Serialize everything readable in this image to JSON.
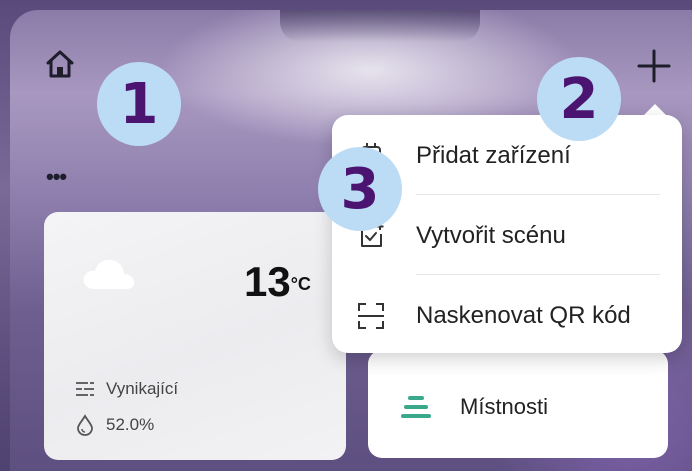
{
  "badges": {
    "one": "1",
    "two": "2",
    "three": "3"
  },
  "weather": {
    "temperature": "13",
    "unit": "°C",
    "air_quality": "Vynikající",
    "humidity": "52.0%"
  },
  "rooms": {
    "label": "Místnosti"
  },
  "menu": {
    "items": [
      {
        "label": "Přidat zařízení",
        "icon": "add-device-icon"
      },
      {
        "label": "Vytvořit scénu",
        "icon": "create-scene-icon"
      },
      {
        "label": "Naskenovat QR kód",
        "icon": "scan-qr-icon"
      }
    ]
  },
  "icons": {
    "home": "home-icon",
    "add": "plus-icon",
    "more": "more-icon",
    "weather": "cloud-icon",
    "air": "air-quality-icon",
    "humidity": "humidity-icon",
    "rooms": "rooms-icon"
  },
  "colors": {
    "badge_bg": "#bcdcf5",
    "badge_text": "#4a1470",
    "rooms_accent": "#3aa88a"
  }
}
